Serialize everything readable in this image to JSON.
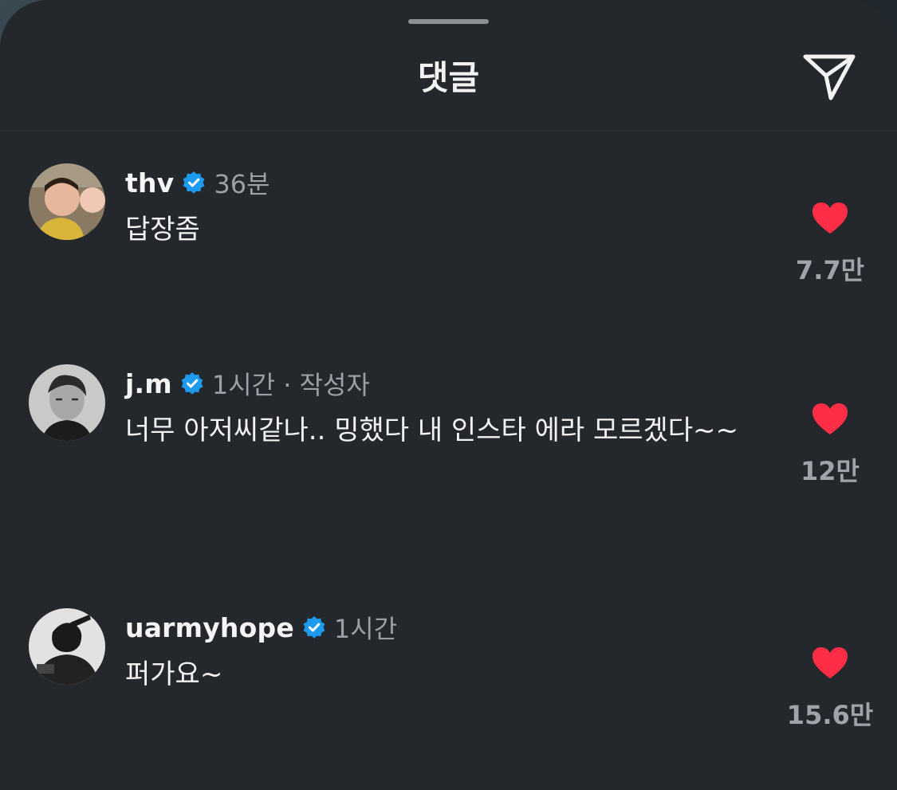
{
  "header": {
    "title": "댓글",
    "share_icon": "paper-plane-icon"
  },
  "comments": [
    {
      "username": "thv",
      "verified": true,
      "time": "36분",
      "text": "답장좀",
      "likes": "7.7만"
    },
    {
      "username": "j.m",
      "verified": true,
      "time": "1시간 · 작성자",
      "text": "너무 아저씨같나.. 밍했다 내 인스타 에라 모르겠다~~",
      "likes": "12만"
    },
    {
      "username": "uarmyhope",
      "verified": true,
      "time": "1시간",
      "text": "퍼가요~",
      "likes": "15.6만"
    }
  ],
  "colors": {
    "background": "#24272c",
    "heart": "#ff2d45",
    "verified": "#1d9bf0",
    "muted_text": "#9aa0a6"
  }
}
